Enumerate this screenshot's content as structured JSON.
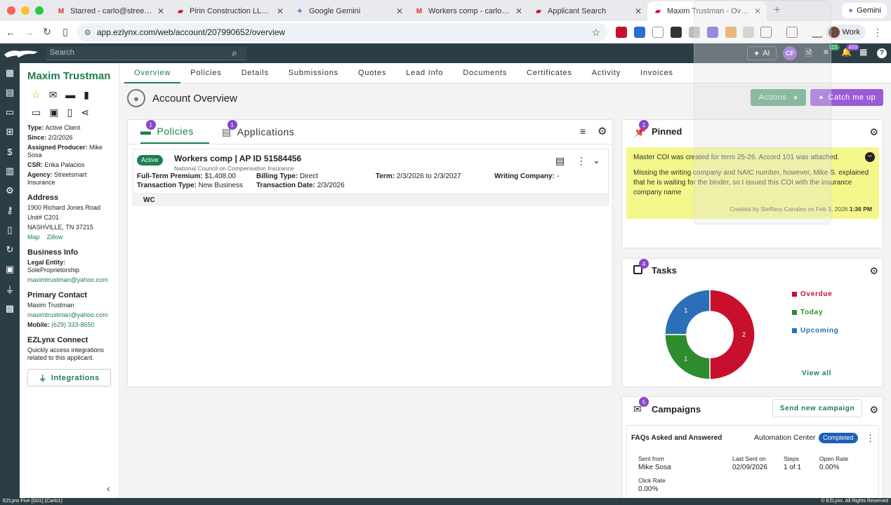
{
  "browser": {
    "tabs": [
      {
        "title": "Starred - carlo@streetsmart.co",
        "icon": "gmail-icon",
        "active": false
      },
      {
        "title": "Pirin Construction LLC - Activity",
        "icon": "ezlynx-icon",
        "active": false
      },
      {
        "title": "Google Gemini",
        "icon": "gemini-icon",
        "active": false
      },
      {
        "title": "Workers comp - carlo@streetsmart",
        "icon": "gmail-icon",
        "active": false
      },
      {
        "title": "Applicant Search",
        "icon": "ezlynx-icon",
        "active": false
      },
      {
        "title": "Maxim Trustman - Overview",
        "icon": "ezlynx-icon",
        "active": true
      }
    ],
    "gemini_label": "Gemini",
    "url": "app.ezlynx.com/web/account/207990652/overview",
    "profile_label": "Work"
  },
  "header": {
    "search_placeholder": "Search",
    "ai_label": "AI",
    "user_initials": "CF",
    "badge_a": "15",
    "badge_b": "469"
  },
  "sidebar": {
    "name": "Maxim Trustman",
    "type_label": "Type:",
    "type_value": "Active Client",
    "since_label": "Since:",
    "since_value": "2/2/2026",
    "producer_label": "Assigned Producer:",
    "producer_value": "Mike Sosa",
    "csr_label": "CSR:",
    "csr_value": "Erika Palacios",
    "agency_label": "Agency:",
    "agency_value": "Streetsmart Insurance",
    "address_heading": "Address",
    "address_line1": "1900 Richard Jones Road",
    "address_line2": "Unit# C201",
    "address_line3": "NASHVILLE, TN 37215",
    "map_link": "Map",
    "zillow_link": "Zillow",
    "business_heading": "Business Info",
    "legal_label": "Legal Entity:",
    "legal_value": "SoleProprietorship",
    "business_email": "maximtrustman@yahoo.com",
    "contact_heading": "Primary Contact",
    "contact_name": "Maxim Trustman",
    "contact_email": "maximtrustman@yahoo.com",
    "mobile_label": "Mobile:",
    "mobile_value": "(629) 333-8650",
    "connect_heading": "EZLynx Connect",
    "connect_text": "Quickly access integrations related to this applicant.",
    "integrations_label": "Integrations"
  },
  "main_tabs": [
    "Overview",
    "Policies",
    "Details",
    "Submissions",
    "Quotes",
    "Lead Info",
    "Documents",
    "Certificates",
    "Activity",
    "Invoices"
  ],
  "overview": {
    "title": "Account Overview",
    "actions_label": "Actions",
    "catch_label": "Catch me up"
  },
  "policies_card": {
    "tab_policies": "Policies",
    "tab_policies_count": "1",
    "tab_applications": "Applications",
    "tab_applications_count": "1",
    "policy": {
      "status": "Active",
      "title": "Workers comp | AP ID 51584456",
      "carrier": "National Council on Compensation Insurance",
      "premium_label": "Full-Term Premium:",
      "premium_value": "$1,408.00",
      "txn_type_label": "Transaction Type:",
      "txn_type_value": "New Business",
      "billing_label": "Billing Type:",
      "billing_value": "Direct",
      "txn_date_label": "Transaction Date:",
      "txn_date_value": "2/3/2026",
      "term_label": "Term:",
      "term_value": "2/3/2026 to 2/3/2027",
      "writing_label": "Writing Company:",
      "writing_value": "-",
      "lob": "WC"
    }
  },
  "pinned": {
    "title": "Pinned",
    "count": "1",
    "note_p1": "Master COI was created for term 25-26. Accord 101 was attached.",
    "note_p2": "Missing the writing company and NAIC number, however, Mike S. explained that he is waiting for the binder, so I issued this COI with the insurance company name",
    "note_meta": "Created by Steffany Canales on Feb 3, 2026",
    "note_time": "1:36 PM"
  },
  "tasks": {
    "title": "Tasks",
    "count": "4",
    "legend": [
      {
        "label": "Overdue",
        "color": "#c8102e"
      },
      {
        "label": "Today",
        "color": "#2e8b2e"
      },
      {
        "label": "Upcoming",
        "color": "#2a6fb8"
      }
    ],
    "view_all": "View all"
  },
  "chart_data": {
    "type": "pie",
    "categories": [
      "Overdue",
      "Today",
      "Upcoming"
    ],
    "values": [
      2,
      1,
      1
    ],
    "colors": [
      "#c8102e",
      "#2e8b2e",
      "#2a6fb8"
    ],
    "title": "",
    "donut": true
  },
  "campaigns": {
    "title": "Campaigns",
    "count": "5",
    "send_label": "Send new campaign",
    "item": {
      "name": "FAQs Asked and Answered",
      "source": "Automation Center",
      "status": "Completed",
      "sent_from_label": "Sent from",
      "sent_from_value": "Mike Sosa",
      "last_sent_label": "Last Sent on",
      "last_sent_value": "02/09/2026",
      "steps_label": "Steps",
      "steps_value": "1 of 1",
      "open_rate_label": "Open Rate",
      "open_rate_value": "0.00%",
      "click_rate_label": "Click Rate",
      "click_rate_value": "0.00%"
    }
  },
  "statusbar": {
    "left": "EZLynx Five [G01] (Carlo1)",
    "right": "© EZLynx. All Rights Reserved"
  }
}
